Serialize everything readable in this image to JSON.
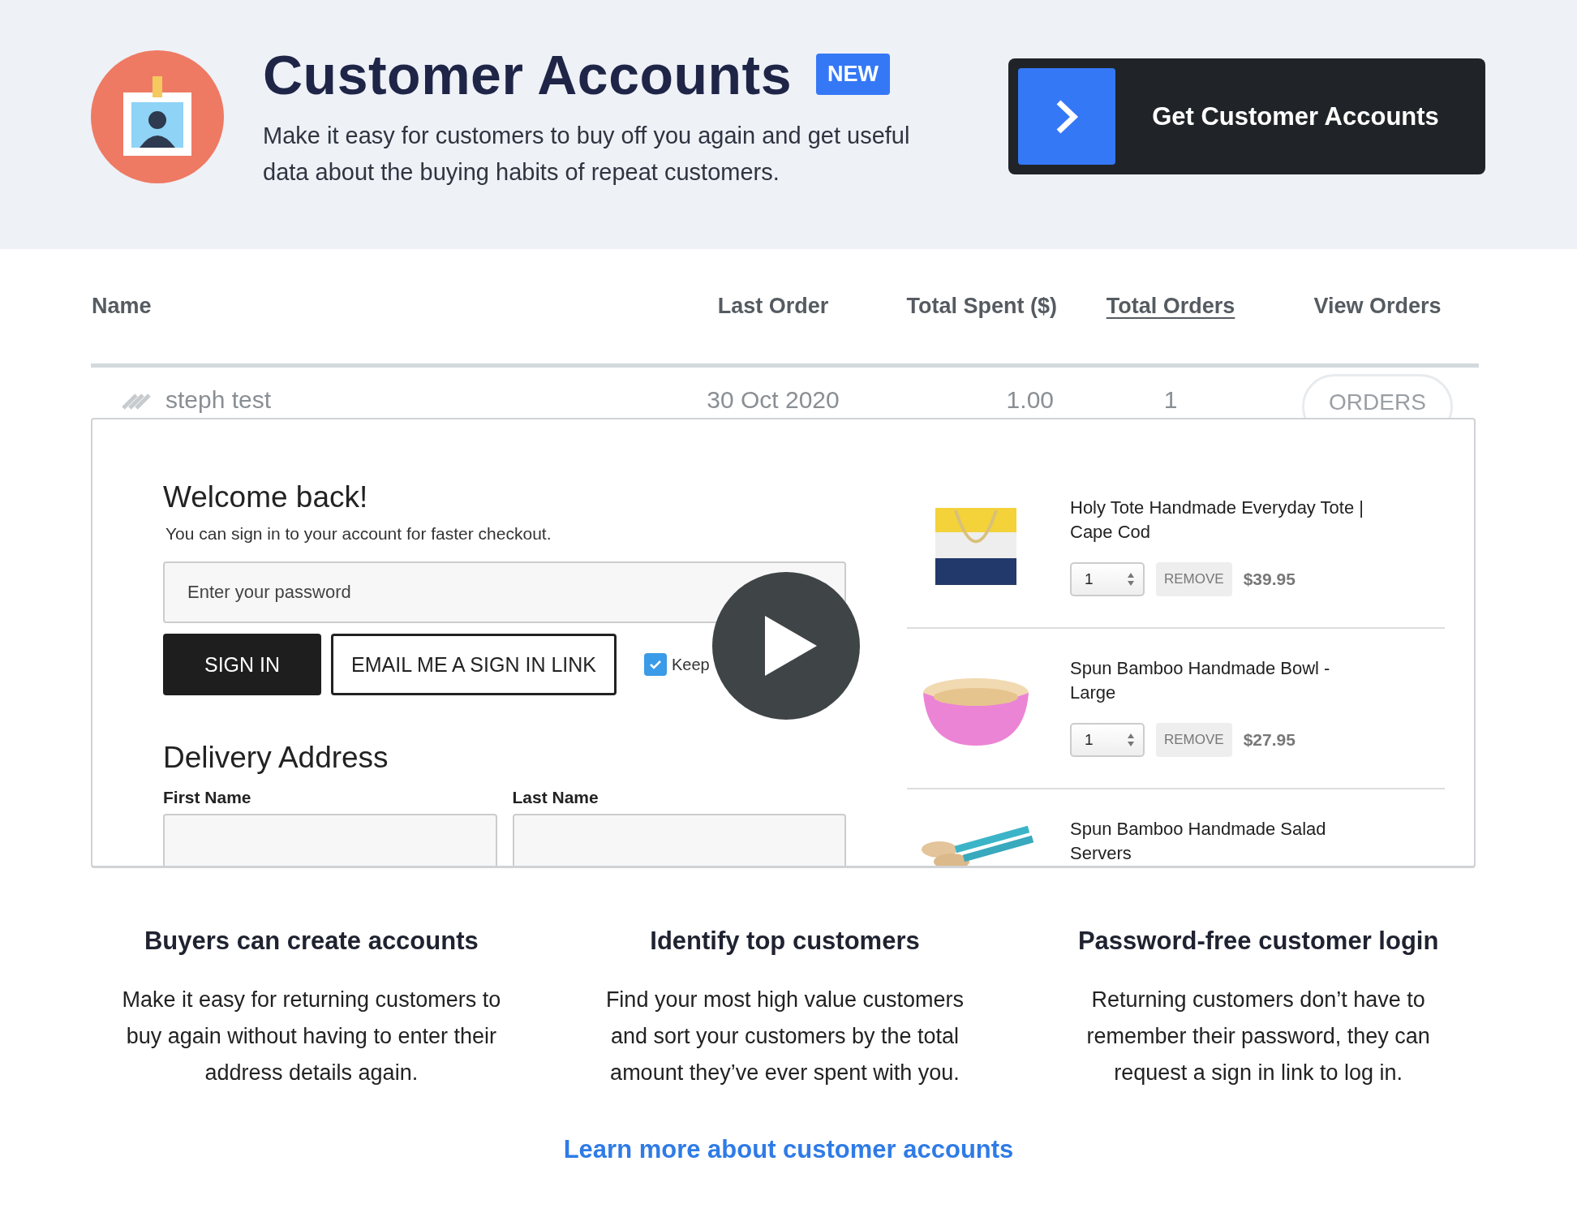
{
  "header": {
    "title": "Customer Accounts",
    "badge": "NEW",
    "description": "Make it easy for customers to buy off you again and get useful data about the buying habits of repeat customers.",
    "cta": "Get Customer Accounts"
  },
  "table": {
    "columns": [
      {
        "label": "Name",
        "sorted": false
      },
      {
        "label": "Last Order",
        "sorted": false
      },
      {
        "label": "Total Spent ($)",
        "sorted": false
      },
      {
        "label": "Total Orders",
        "sorted": true
      },
      {
        "label": "View Orders",
        "sorted": false
      }
    ],
    "rows": [
      {
        "name": "steph test",
        "last_order": "30 Oct 2020",
        "total_spent": "1.00",
        "total_orders": "1",
        "action": "ORDERS"
      }
    ]
  },
  "preview": {
    "login": {
      "heading": "Welcome back!",
      "subtitle": "You can sign in to your account for faster checkout.",
      "password_placeholder": "Enter your password",
      "sign_in": "SIGN IN",
      "email_link": "EMAIL ME A SIGN IN LINK",
      "keep_signed_in": {
        "label": "Keep",
        "checked": true
      }
    },
    "delivery": {
      "heading": "Delivery Address",
      "fields": [
        {
          "label": "First Name"
        },
        {
          "label": "Last Name"
        }
      ]
    },
    "cart": [
      {
        "title": "Holy Tote Handmade Everyday Tote | Cape Cod",
        "qty": "1",
        "remove": "REMOVE",
        "price": "$39.95"
      },
      {
        "title": "Spun Bamboo Handmade Bowl - Large",
        "qty": "1",
        "remove": "REMOVE",
        "price": "$27.95"
      },
      {
        "title": "Spun Bamboo Handmade Salad Servers"
      }
    ]
  },
  "features": [
    {
      "title": "Buyers can create accounts",
      "text": "Make it easy for returning customers to buy again without having to enter their address details again."
    },
    {
      "title": "Identify top customers",
      "text": "Find your most high value customers and sort your customers by the total amount they’ve ever spent with you."
    },
    {
      "title": "Password-free customer login",
      "text": "Returning customers don’t have to remember their password, they can request a sign in link to log in."
    }
  ],
  "link": "Learn more about customer accounts"
}
